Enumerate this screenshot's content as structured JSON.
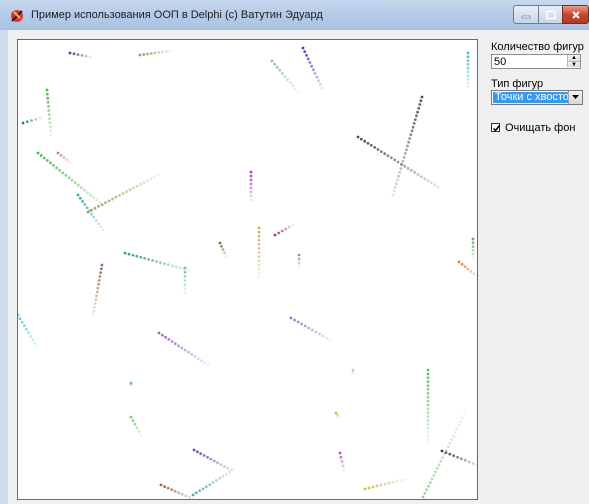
{
  "window": {
    "title": "Пример использования ООП в Delphi (c) Ватутин Эдуард"
  },
  "controls": {
    "count_label": "Количество фигур",
    "count_value": "50",
    "type_label": "Тип фигур",
    "type_selected": "Точки с хвостом",
    "clear_label": "Очищать фон",
    "clear_checked": true
  },
  "icons": {
    "app": "delphi-app-icon",
    "minimize": "minimize-icon",
    "maximize": "maximize-icon",
    "close": "close-icon",
    "spin_up": "chevron-up-icon",
    "spin_down": "chevron-down-icon",
    "dropdown": "chevron-down-icon",
    "check": "checkmark-icon"
  },
  "colors": {
    "selection": "#3399ff",
    "close_button": "#c9462b",
    "canvas": "#ffffff"
  }
}
